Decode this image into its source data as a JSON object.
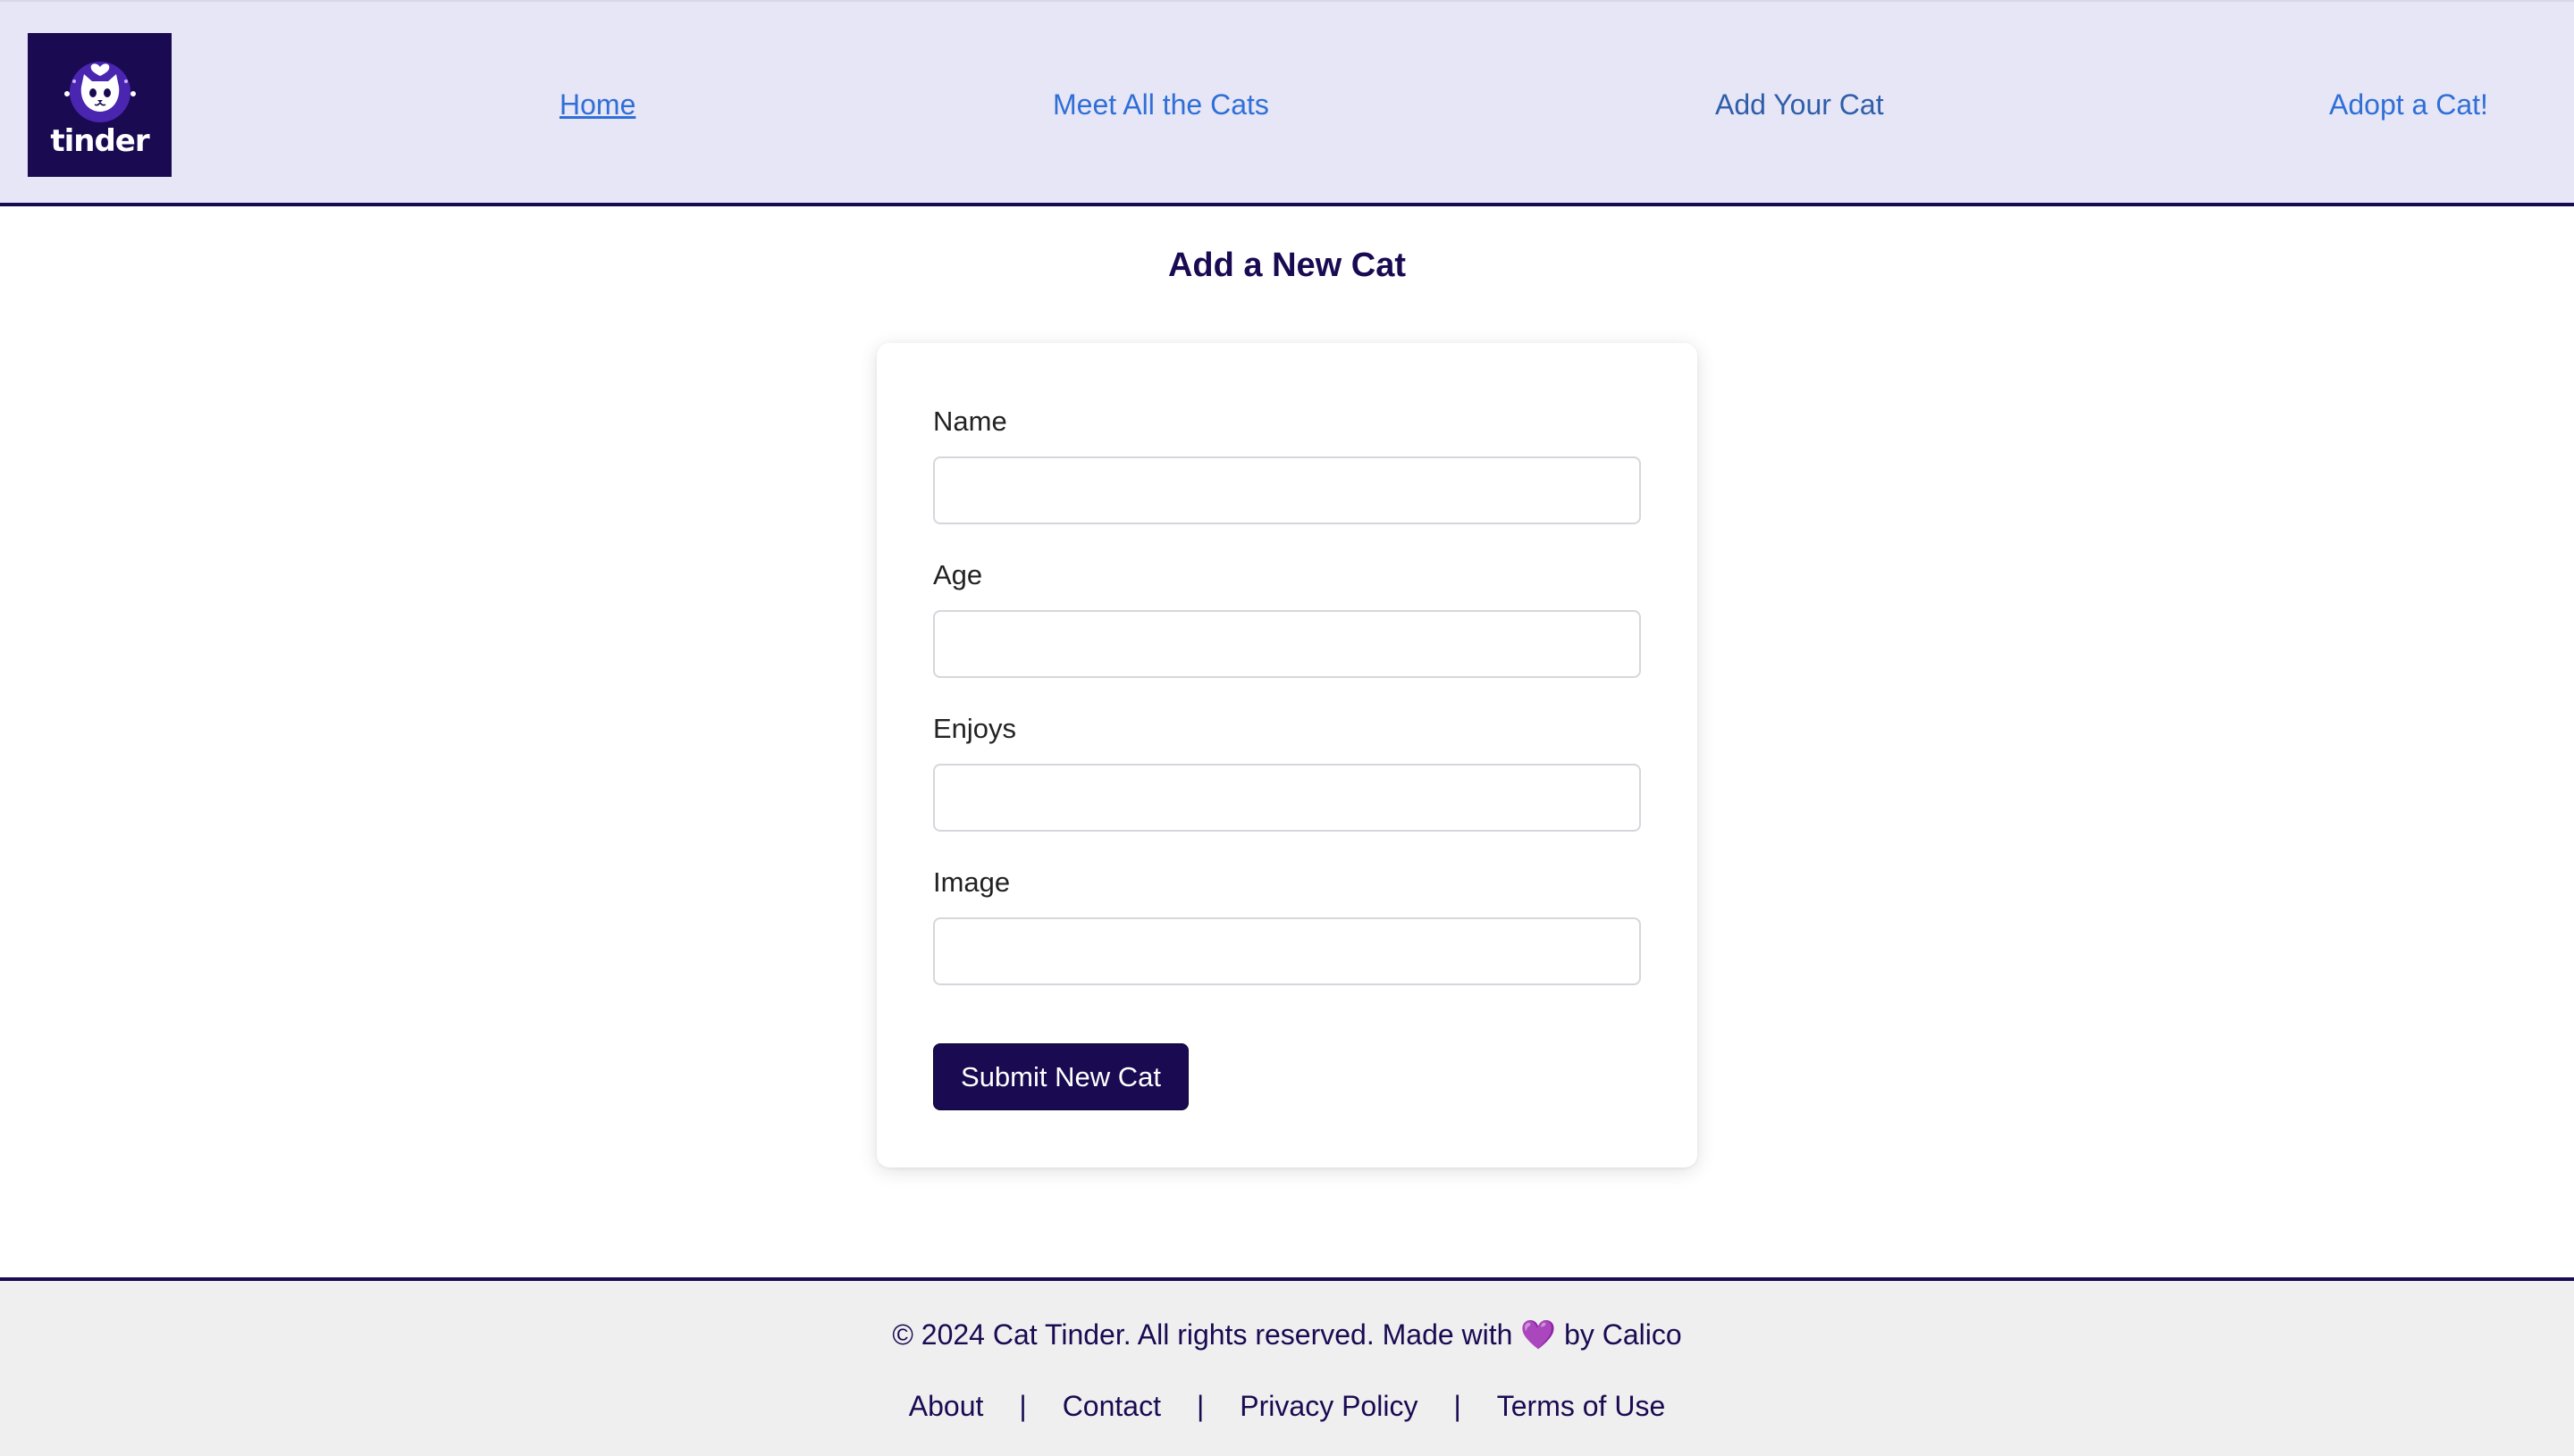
{
  "header": {
    "logo_text": "tinder",
    "nav": [
      {
        "label": "Home",
        "active": true
      },
      {
        "label": "Meet All the Cats",
        "active": false
      },
      {
        "label": "Add Your Cat",
        "active": false
      },
      {
        "label": "Adopt a Cat!",
        "active": false
      }
    ]
  },
  "main": {
    "title": "Add a New Cat",
    "form": {
      "fields": [
        {
          "label": "Name",
          "value": "",
          "placeholder": ""
        },
        {
          "label": "Age",
          "value": "",
          "placeholder": ""
        },
        {
          "label": "Enjoys",
          "value": "",
          "placeholder": ""
        },
        {
          "label": "Image",
          "value": "",
          "placeholder": ""
        }
      ],
      "submit_label": "Submit New Cat"
    }
  },
  "footer": {
    "copyright_before": "© 2024 Cat Tinder. All rights reserved. Made with",
    "heart": "💜",
    "copyright_after": "by Calico",
    "links": [
      "About",
      "Contact",
      "Privacy Policy",
      "Terms of Use"
    ],
    "separator": "|"
  },
  "colors": {
    "brand_dark": "#1a0a52",
    "header_bg": "#e6e6f7",
    "link": "#2f6fd6",
    "footer_bg": "#efefef"
  },
  "icons": {
    "logo": "cat-face-icon"
  }
}
